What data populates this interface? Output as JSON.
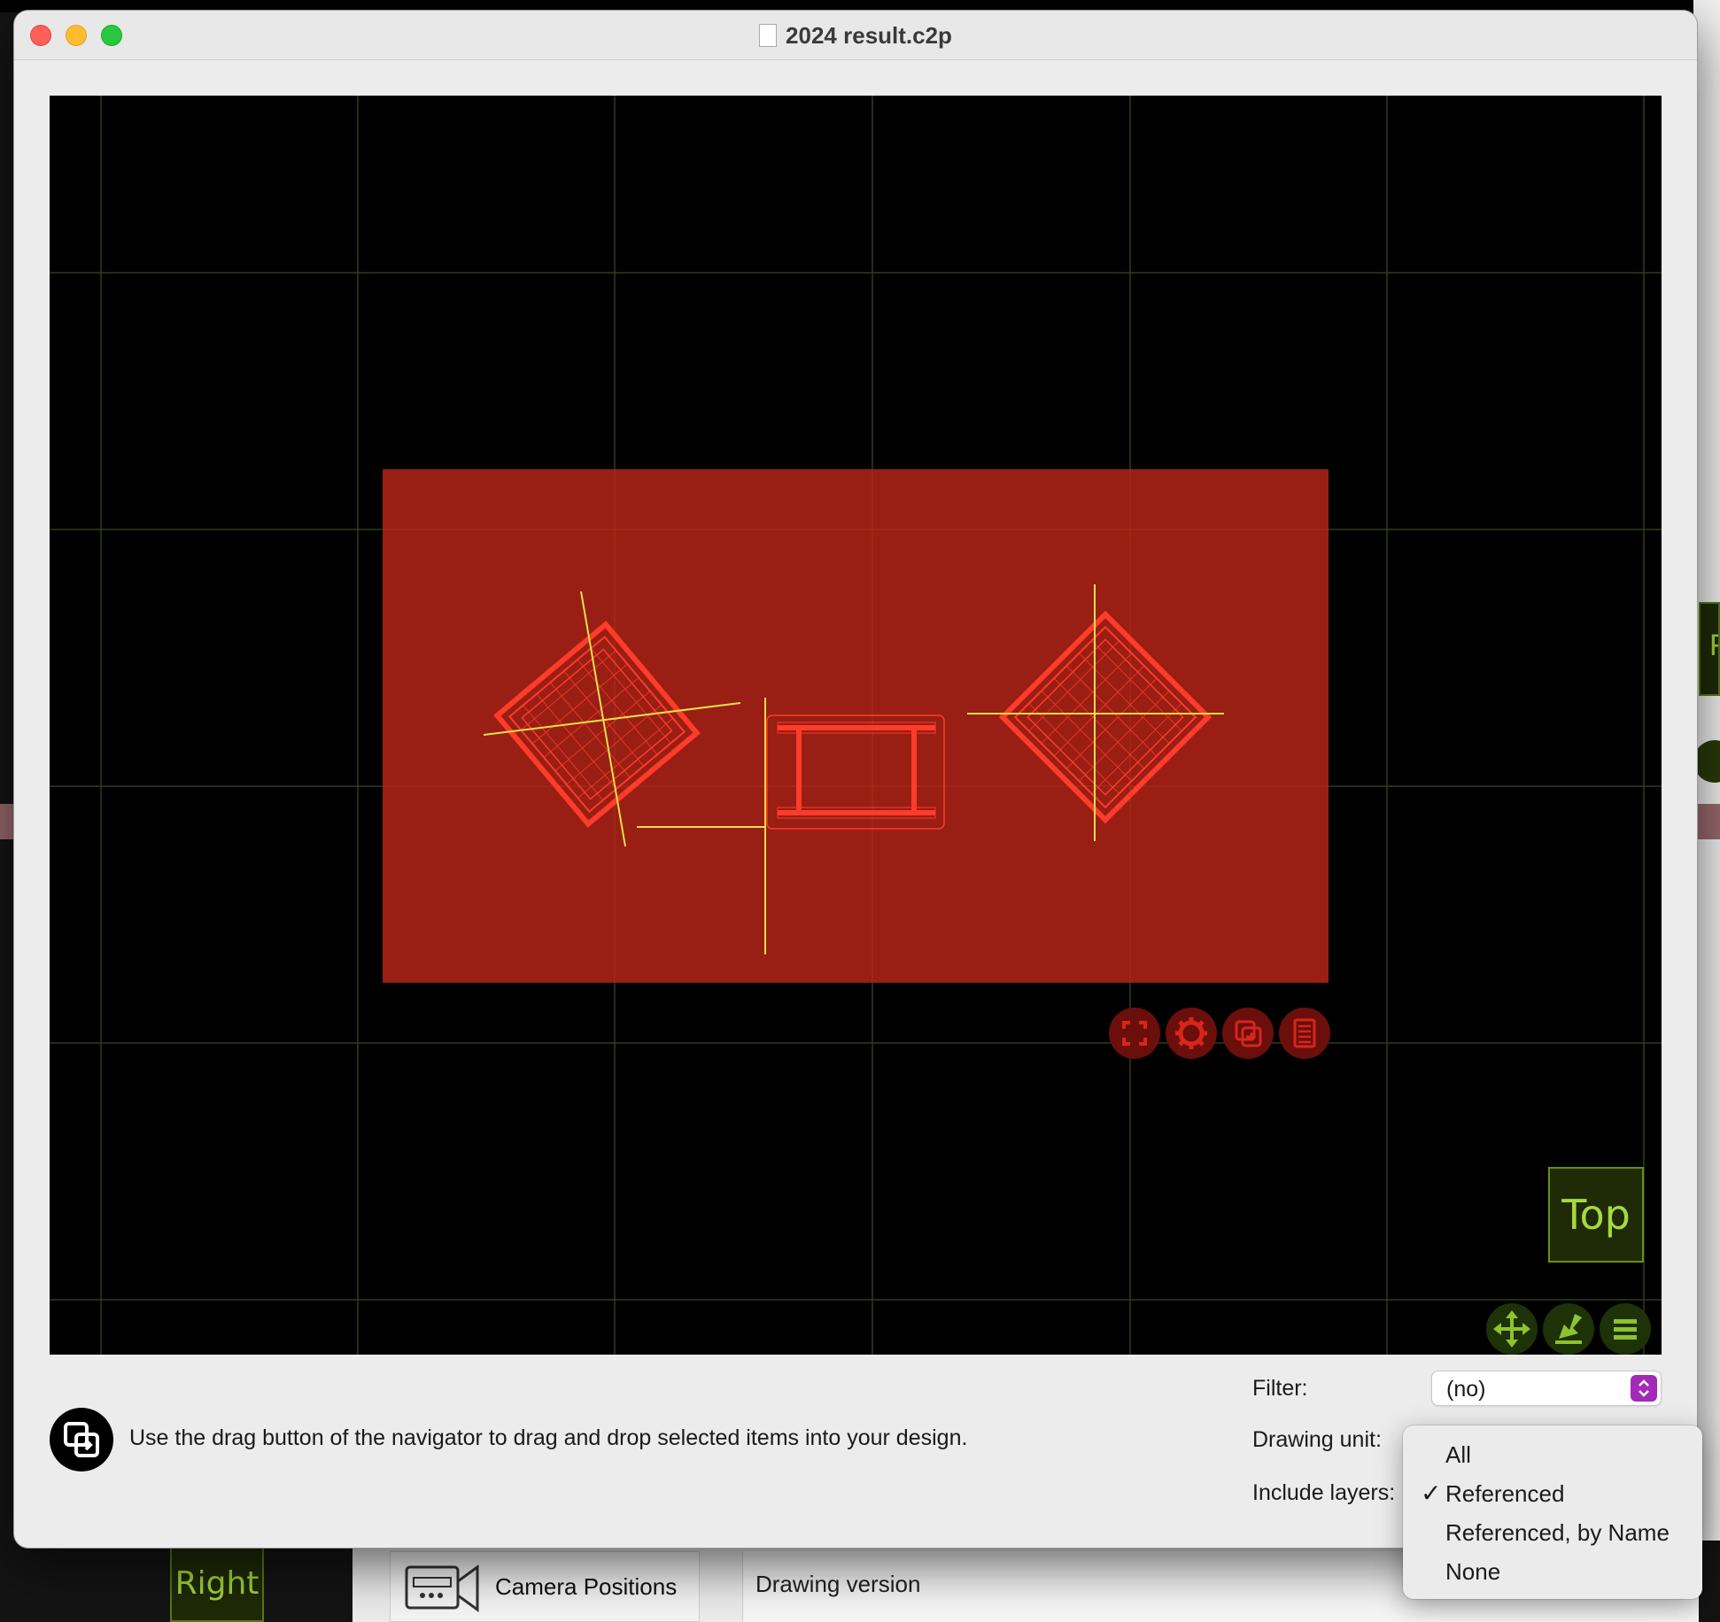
{
  "window": {
    "title": "2024 result.c2p"
  },
  "viewport": {
    "view_label": "Top"
  },
  "viewport_tools": {
    "icons": [
      "fit-view-icon",
      "gear-icon",
      "drag-copy-icon",
      "list-icon"
    ]
  },
  "navigator_tools": {
    "icons": [
      "move-arrows-icon",
      "download-arrow-icon",
      "menu-lines-icon"
    ]
  },
  "colors": {
    "viewport_bg": "#000000",
    "grid": "#2e3d1a",
    "selection_fill": "#991e14",
    "wire": "#ff3b2a",
    "axis": "#e8e04a",
    "accent_green": "#a8d93c",
    "select_accent": "#a32ab6"
  },
  "footer": {
    "hint": "Use the drag button of the navigator to drag and drop selected items into your design.",
    "filter_label": "Filter:",
    "filter_value": "(no)",
    "drawing_unit_label": "Drawing unit:",
    "include_layers_label": "Include layers:"
  },
  "include_layers_menu": {
    "items": [
      {
        "label": "All",
        "checked": false
      },
      {
        "label": "Referenced",
        "checked": true
      },
      {
        "label": "Referenced, by Name",
        "checked": false
      },
      {
        "label": "None",
        "checked": false
      }
    ],
    "check_glyph": "✓"
  },
  "background_app": {
    "right_label": "Right",
    "camera_positions": "Camera Positions",
    "drawing_version": "Drawing version"
  }
}
